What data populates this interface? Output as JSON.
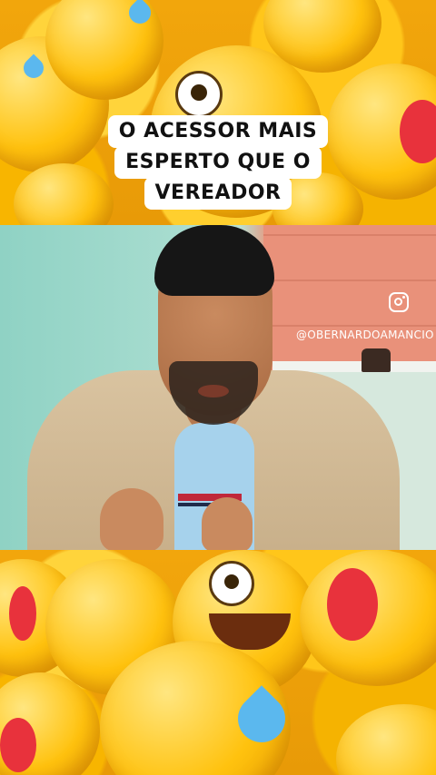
{
  "caption": {
    "line1": "O ACESSOR MAIS",
    "line2": "ESPERTO QUE O",
    "line3": "VEREADOR"
  },
  "overlay": {
    "instagram_icon": "instagram-icon",
    "handle": "@OBERNARDOAMANCIO"
  },
  "colors": {
    "background_emoji": "#ffc20e",
    "caption_bg": "#ffffff",
    "caption_text": "#111111"
  }
}
